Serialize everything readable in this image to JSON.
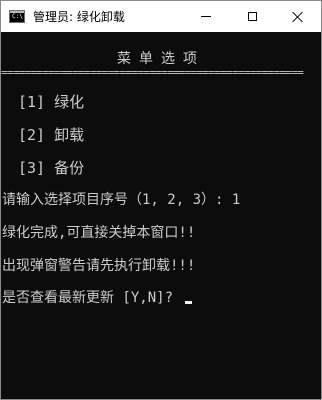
{
  "window": {
    "title": "管理员:  绿化卸载",
    "icon_text": "C:\\",
    "controls": {
      "minimize": "minimize-icon",
      "maximize": "maximize-icon",
      "close": "close-icon"
    }
  },
  "console": {
    "heading": "菜单选项",
    "separator": "===================================================",
    "menu": [
      {
        "label": "[1] 绿化"
      },
      {
        "label": "[2] 卸载"
      },
      {
        "label": "[3] 备份"
      }
    ],
    "prompt": "请输入选择项目序号（1, 2, 3）: 1",
    "message_done": "绿化完成,可直接关掉本窗口!!",
    "message_warn": "出现弹窗警告请先执行卸载!!!",
    "question": "是否查看最新更新 [Y,N]? "
  },
  "colors": {
    "background": "#0c0c0c",
    "text": "#cccccc",
    "titlebar": "#ffffff"
  }
}
